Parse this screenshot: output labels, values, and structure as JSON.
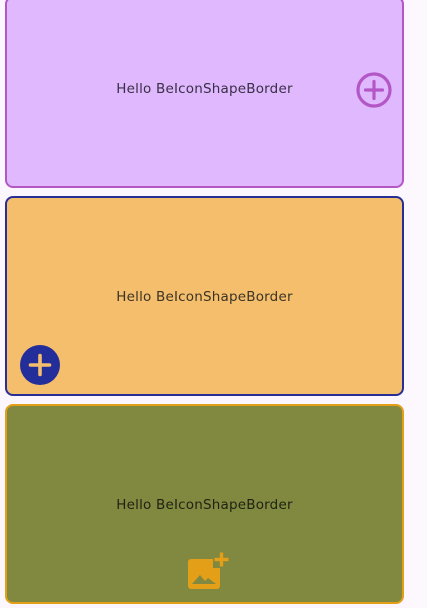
{
  "cards": [
    {
      "label": "Hello BeIconShapeBorder",
      "icon": "add-circle-outline-icon",
      "background": "#dfb8fe",
      "border": "#b457c6",
      "icon_color": "#b457c6",
      "text_color": "#3a2f45"
    },
    {
      "label": "Hello BeIconShapeBorder",
      "icon": "add-circle-filled-icon",
      "background": "#f4be6d",
      "border": "#272f97",
      "icon_color": "#232e9a",
      "icon_glyph_color": "#f4be6d",
      "text_color": "#3b3426"
    },
    {
      "label": "Hello BeIconShapeBorder",
      "icon": "add-photo-icon",
      "background": "#818840",
      "border": "#e39f18",
      "icon_color": "#e39f18",
      "text_color": "#1f2213"
    }
  ]
}
